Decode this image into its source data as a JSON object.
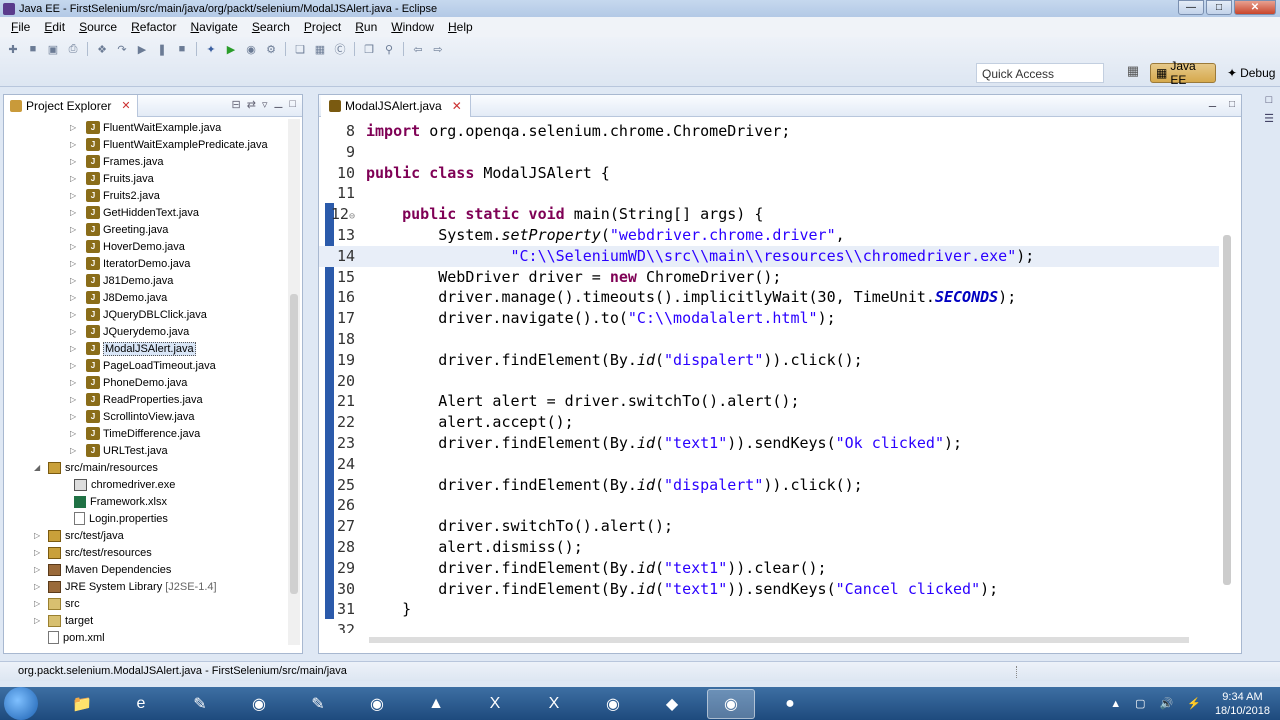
{
  "window": {
    "title": "Java EE - FirstSelenium/src/main/java/org/packt/selenium/ModalJSAlert.java - Eclipse"
  },
  "menu": [
    "File",
    "Edit",
    "Source",
    "Refactor",
    "Navigate",
    "Search",
    "Project",
    "Run",
    "Window",
    "Help"
  ],
  "toolbar": {
    "quick_access": "Quick Access",
    "perspectives": [
      "Java EE",
      "Debug"
    ]
  },
  "project_explorer": {
    "title": "Project Explorer",
    "items": [
      {
        "label": "FluentWaitExample.java",
        "kind": "java"
      },
      {
        "label": "FluentWaitExamplePredicate.java",
        "kind": "java"
      },
      {
        "label": "Frames.java",
        "kind": "java"
      },
      {
        "label": "Fruits.java",
        "kind": "java"
      },
      {
        "label": "Fruits2.java",
        "kind": "java"
      },
      {
        "label": "GetHiddenText.java",
        "kind": "java"
      },
      {
        "label": "Greeting.java",
        "kind": "java"
      },
      {
        "label": "HoverDemo.java",
        "kind": "java"
      },
      {
        "label": "IteratorDemo.java",
        "kind": "java"
      },
      {
        "label": "J81Demo.java",
        "kind": "java"
      },
      {
        "label": "J8Demo.java",
        "kind": "java"
      },
      {
        "label": "JQueryDBLClick.java",
        "kind": "java"
      },
      {
        "label": "JQuerydemo.java",
        "kind": "java"
      },
      {
        "label": "ModalJSAlert.java",
        "kind": "java",
        "selected": true
      },
      {
        "label": "PageLoadTimeout.java",
        "kind": "java"
      },
      {
        "label": "PhoneDemo.java",
        "kind": "java"
      },
      {
        "label": "ReadProperties.java",
        "kind": "java"
      },
      {
        "label": "ScrollintoView.java",
        "kind": "java"
      },
      {
        "label": "TimeDifference.java",
        "kind": "java"
      },
      {
        "label": "URLTest.java",
        "kind": "java"
      },
      {
        "label": "src/main/resources",
        "kind": "srcfolder-open"
      },
      {
        "label": "chromedriver.exe",
        "kind": "exe"
      },
      {
        "label": "Framework.xlsx",
        "kind": "xlsx"
      },
      {
        "label": "Login.properties",
        "kind": "file"
      },
      {
        "label": "src/test/java",
        "kind": "srcfolder"
      },
      {
        "label": "src/test/resources",
        "kind": "srcfolder"
      },
      {
        "label": "Maven Dependencies",
        "kind": "lib"
      },
      {
        "label": "JRE System Library",
        "suffix": "[J2SE-1.4]",
        "kind": "lib"
      },
      {
        "label": "src",
        "kind": "folder"
      },
      {
        "label": "target",
        "kind": "folder"
      },
      {
        "label": "pom.xml",
        "kind": "file"
      }
    ]
  },
  "editor": {
    "tab_label": "ModalJSAlert.java",
    "lines": [
      {
        "n": "8",
        "html": "<span class=\"kw\">import</span> org.openqa.selenium.chrome.ChromeDriver;"
      },
      {
        "n": "9",
        "html": ""
      },
      {
        "n": "10",
        "html": "<span class=\"kw\">public class</span> ModalJSAlert {"
      },
      {
        "n": "11",
        "html": ""
      },
      {
        "n": "12",
        "html": "    <span class=\"kw\">public static void</span> main(String[] args) {"
      },
      {
        "n": "13",
        "html": "        System.<span class=\"it\">setProperty</span>(<span class=\"str\">\"webdriver.chrome.driver\"</span>,"
      },
      {
        "n": "14",
        "html": "                <span class=\"str\">\"C:\\\\SeleniumWD\\\\src\\\\main\\\\resources\\\\chromedriver.exe\"</span>);",
        "highlight": true
      },
      {
        "n": "15",
        "html": "        WebDriver driver = <span class=\"kw\">new</span> ChromeDriver();"
      },
      {
        "n": "16",
        "html": "        driver.manage().timeouts().implicitlyWait(30, TimeUnit.<span class=\"st\">SECONDS</span>);"
      },
      {
        "n": "17",
        "html": "        driver.navigate().to(<span class=\"str\">\"C:\\\\modalalert.html\"</span>);"
      },
      {
        "n": "18",
        "html": ""
      },
      {
        "n": "19",
        "html": "        driver.findElement(By.<span class=\"it\">id</span>(<span class=\"str\">\"dispalert\"</span>)).click();"
      },
      {
        "n": "20",
        "html": ""
      },
      {
        "n": "21",
        "html": "        Alert alert = driver.switchTo().alert();"
      },
      {
        "n": "22",
        "html": "        alert.accept();"
      },
      {
        "n": "23",
        "html": "        driver.findElement(By.<span class=\"it\">id</span>(<span class=\"str\">\"text1\"</span>)).sendKeys(<span class=\"str\">\"Ok clicked\"</span>);"
      },
      {
        "n": "24",
        "html": ""
      },
      {
        "n": "25",
        "html": "        driver.findElement(By.<span class=\"it\">id</span>(<span class=\"str\">\"dispalert\"</span>)).click();"
      },
      {
        "n": "26",
        "html": ""
      },
      {
        "n": "27",
        "html": "        driver.switchTo().alert();"
      },
      {
        "n": "28",
        "html": "        alert.dismiss();"
      },
      {
        "n": "29",
        "html": "        driver.findElement(By.<span class=\"it\">id</span>(<span class=\"str\">\"text1\"</span>)).clear();"
      },
      {
        "n": "30",
        "html": "        driver.findElement(By.<span class=\"it\">id</span>(<span class=\"str\">\"text1\"</span>)).sendKeys(<span class=\"str\">\"Cancel clicked\"</span>);"
      },
      {
        "n": "31",
        "html": "    }"
      },
      {
        "n": "32",
        "html": ""
      }
    ]
  },
  "status_bar": {
    "text": "org.packt.selenium.ModalJSAlert.java - FirstSelenium/src/main/java"
  },
  "taskbar": {
    "time": "9:34 AM",
    "date": "18/10/2018"
  }
}
